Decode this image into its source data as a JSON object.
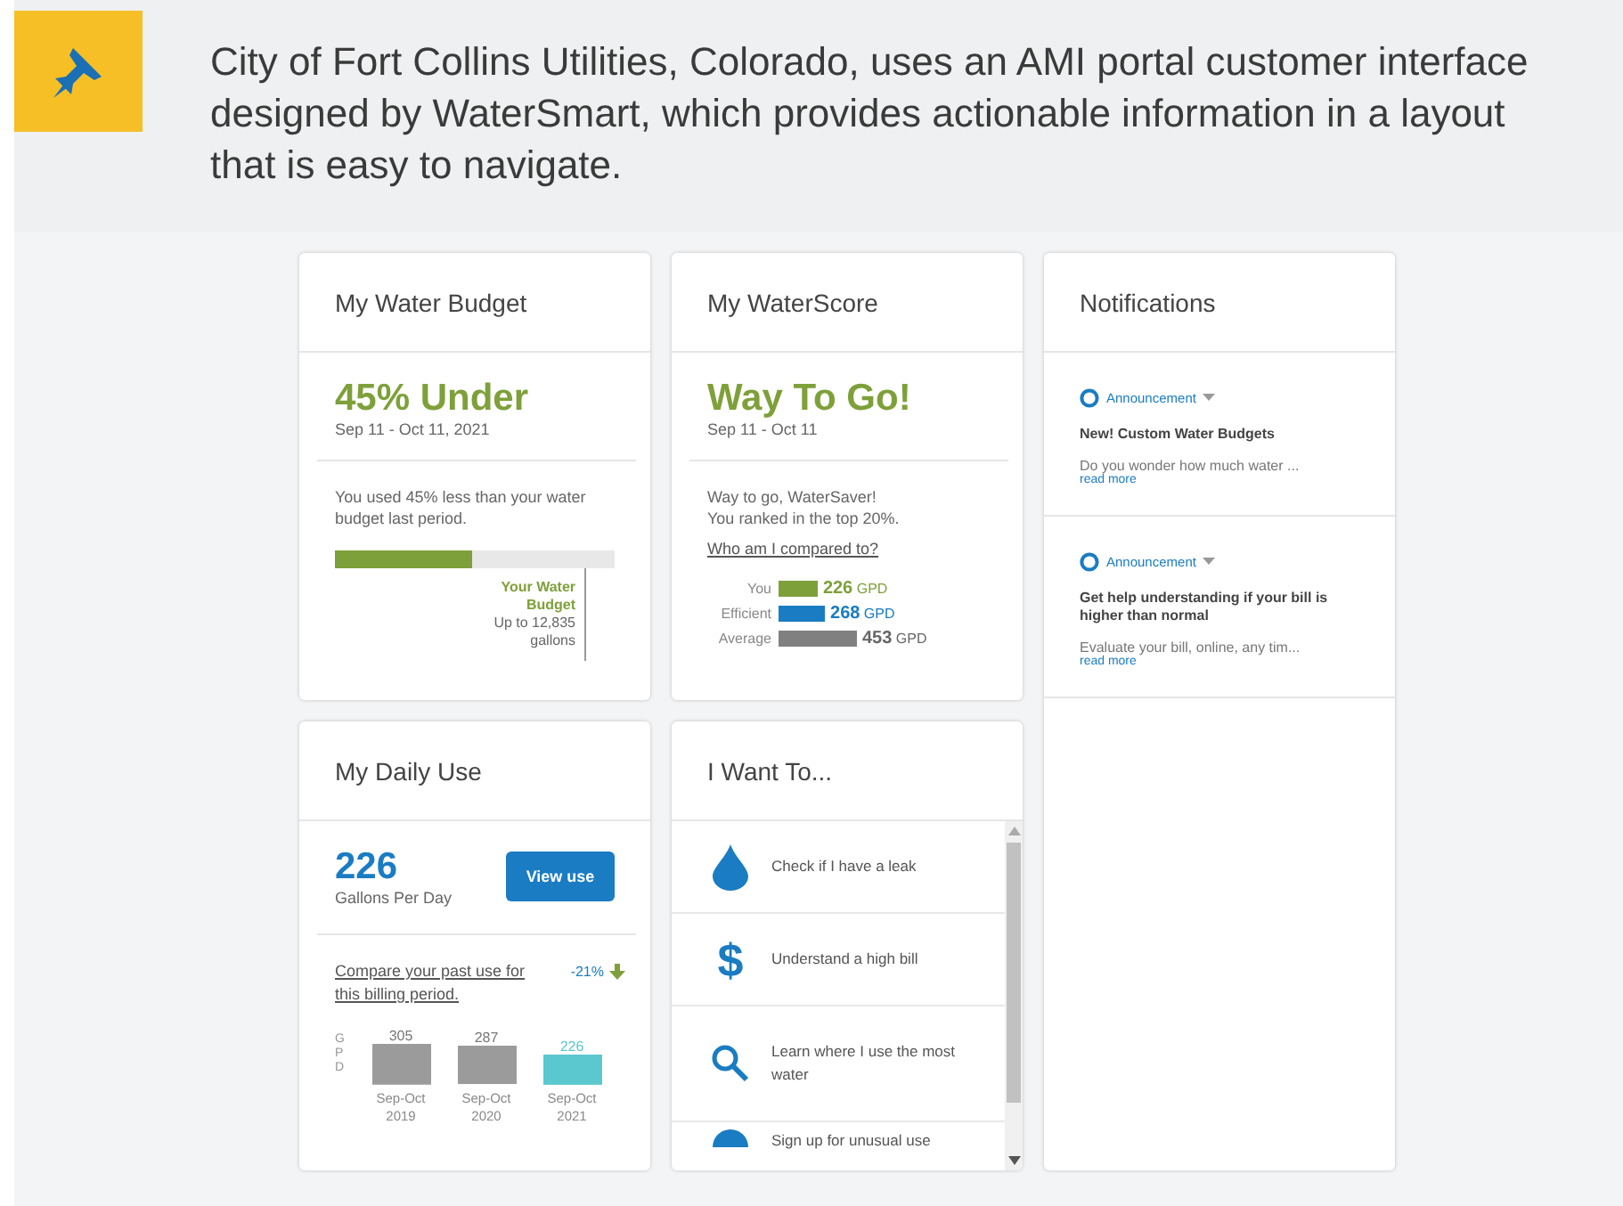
{
  "banner": {
    "text": "City of Fort Collins Utilities, Colorado, uses an AMI portal customer interface designed by WaterSmart, which provides actionable information in a layout that is easy to navigate."
  },
  "budget": {
    "title": "My Water Budget",
    "headline": "45% Under",
    "period": "Sep 11 - Oct 11, 2021",
    "message": "You used 45% less than your water budget last period.",
    "level": 0.49,
    "limit_label": "Your Water Budget",
    "limit_text": "Up to 12,835 gallons"
  },
  "score": {
    "title": "My WaterScore",
    "headline": "Way To Go!",
    "period": "Sep 11 - Oct 11",
    "message_lines": [
      "Way to go, WaterSaver!",
      "You ranked in the top 20%."
    ],
    "link": "Who am I compared to?",
    "rows": [
      {
        "label": "You",
        "value": "226",
        "unit": "GPD",
        "color": "#7ea03a"
      },
      {
        "label": "Efficient",
        "value": "268",
        "unit": "GPD",
        "color": "#1a7cc2"
      },
      {
        "label": "Average",
        "value": "453",
        "unit": "GPD",
        "color": "#808080"
      }
    ]
  },
  "notifications": {
    "title": "Notifications",
    "items": [
      {
        "tag": "Announcement",
        "title": "New! Custom Water Budgets",
        "excerpt": "Do you wonder how much water ...",
        "link": "read more"
      },
      {
        "tag": "Announcement",
        "title": "Get help understanding if your bill is higher than normal",
        "excerpt": "Evaluate your bill, online, any tim...",
        "link": "read more"
      }
    ]
  },
  "daily": {
    "title": "My Daily Use",
    "value": "226",
    "unit": "Gallons Per Day",
    "button": "View use",
    "compare_link": "Compare your past use for this billing period.",
    "change": "-21%",
    "chart_data": {
      "type": "bar",
      "ylabel": "GPD",
      "categories": [
        "Sep-Oct 2019",
        "Sep-Oct 2020",
        "Sep-Oct 2021"
      ],
      "stacked": true,
      "data_labels": true,
      "series": [
        {
          "color": "#9b9b9b",
          "values": [
            305,
            287,
            null
          ]
        },
        {
          "color": "#5bc8cf",
          "values": [
            null,
            null,
            226
          ]
        }
      ]
    }
  },
  "actions": {
    "title": "I Want To...",
    "items": [
      {
        "kind": "drop",
        "label": "Check if I have a leak"
      },
      {
        "kind": "dollar",
        "icon_text": "$",
        "label": "Understand a high bill"
      },
      {
        "kind": "search",
        "label": "Learn where I use the most water"
      },
      {
        "kind": "info",
        "label": "Sign up for unusual use"
      }
    ]
  }
}
